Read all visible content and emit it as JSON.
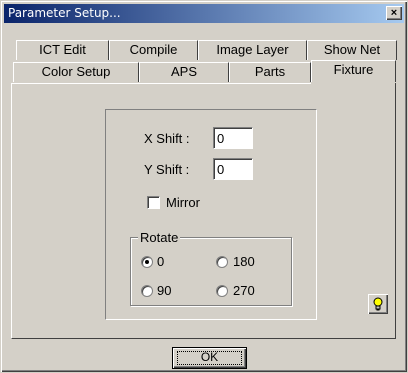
{
  "window": {
    "title": "Parameter Setup...",
    "close_glyph": "×"
  },
  "tabs_row1": [
    "ICT Edit",
    "Compile",
    "Image Layer",
    "Show Net"
  ],
  "tabs_row2": [
    "Color Setup",
    "APS",
    "Parts",
    "Fixture"
  ],
  "active_tab": "Fixture",
  "fixture": {
    "x_shift_label": "X Shift :",
    "x_shift_value": "0",
    "y_shift_label": "Y Shift :",
    "y_shift_value": "0",
    "mirror_label": "Mirror",
    "mirror_checked": false,
    "rotate_label": "Rotate",
    "rotate_options": [
      "0",
      "180",
      "90",
      "270"
    ],
    "rotate_selected": "0"
  },
  "icons": {
    "hint": "lightbulb-icon"
  },
  "buttons": {
    "ok": "OK"
  },
  "colors": {
    "dialog_bg": "#d4d0c8",
    "title_start": "#0a246a",
    "title_end": "#a6caf0"
  }
}
